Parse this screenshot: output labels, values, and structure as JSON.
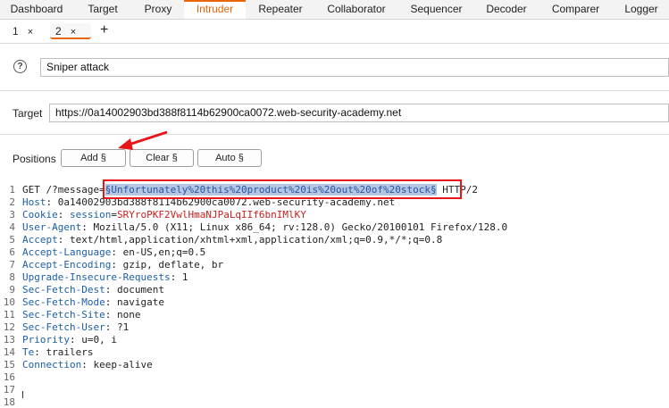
{
  "main_tabs": [
    "Dashboard",
    "Target",
    "Proxy",
    "Intruder",
    "Repeater",
    "Collaborator",
    "Sequencer",
    "Decoder",
    "Comparer",
    "Logger"
  ],
  "active_tab": "Intruder",
  "sub_tabs": [
    {
      "label": "1",
      "close": "×"
    },
    {
      "label": "2",
      "close": "×"
    }
  ],
  "add_tab": "+",
  "attack_type": {
    "help_icon": "?",
    "value": "Sniper attack"
  },
  "target": {
    "label": "Target",
    "value": "https://0a14002903bd388f8114b62900ca0072.web-security-academy.net"
  },
  "positions": {
    "label": "Positions",
    "add_button": "Add §",
    "clear_button": "Clear §",
    "auto_button": "Auto §"
  },
  "request": {
    "line1_pre": "GET /?message=",
    "line1_payload": "§Unfortunately%20this%20product%20is%20out%20of%20stock§",
    "line1_post": " HTTP/2",
    "headers": [
      {
        "name": "Host",
        "value": "0a14002903bd388f8114b62900ca0072.web-security-academy.net"
      },
      {
        "name": "Cookie",
        "value": "session=SRYroPKF2VwlHmaNJPaLqIIf6bnIMlKY"
      },
      {
        "name": "User-Agent",
        "value": "Mozilla/5.0 (X11; Linux x86_64; rv:128.0) Gecko/20100101 Firefox/128.0"
      },
      {
        "name": "Accept",
        "value": "text/html,application/xhtml+xml,application/xml;q=0.9,*/*;q=0.8"
      },
      {
        "name": "Accept-Language",
        "value": "en-US,en;q=0.5"
      },
      {
        "name": "Accept-Encoding",
        "value": "gzip, deflate, br"
      },
      {
        "name": "Upgrade-Insecure-Requests",
        "value": "1"
      },
      {
        "name": "Sec-Fetch-Dest",
        "value": "document"
      },
      {
        "name": "Sec-Fetch-Mode",
        "value": "navigate"
      },
      {
        "name": "Sec-Fetch-Site",
        "value": "none"
      },
      {
        "name": "Sec-Fetch-User",
        "value": "?1"
      },
      {
        "name": "Priority",
        "value": "u=0, i"
      },
      {
        "name": "Te",
        "value": "trailers"
      },
      {
        "name": "Connection",
        "value": "keep-alive"
      }
    ],
    "line_numbers": [
      "1",
      "2",
      "3",
      "4",
      "5",
      "6",
      "7",
      "8",
      "9",
      "10",
      "11",
      "12",
      "13",
      "14",
      "15",
      "16",
      "17",
      "18"
    ]
  },
  "colors": {
    "accent": "#e8650a",
    "highlight_box": "#e8161b",
    "header_name": "#1d5fa6",
    "payload_bg": "#b5c7e0"
  }
}
